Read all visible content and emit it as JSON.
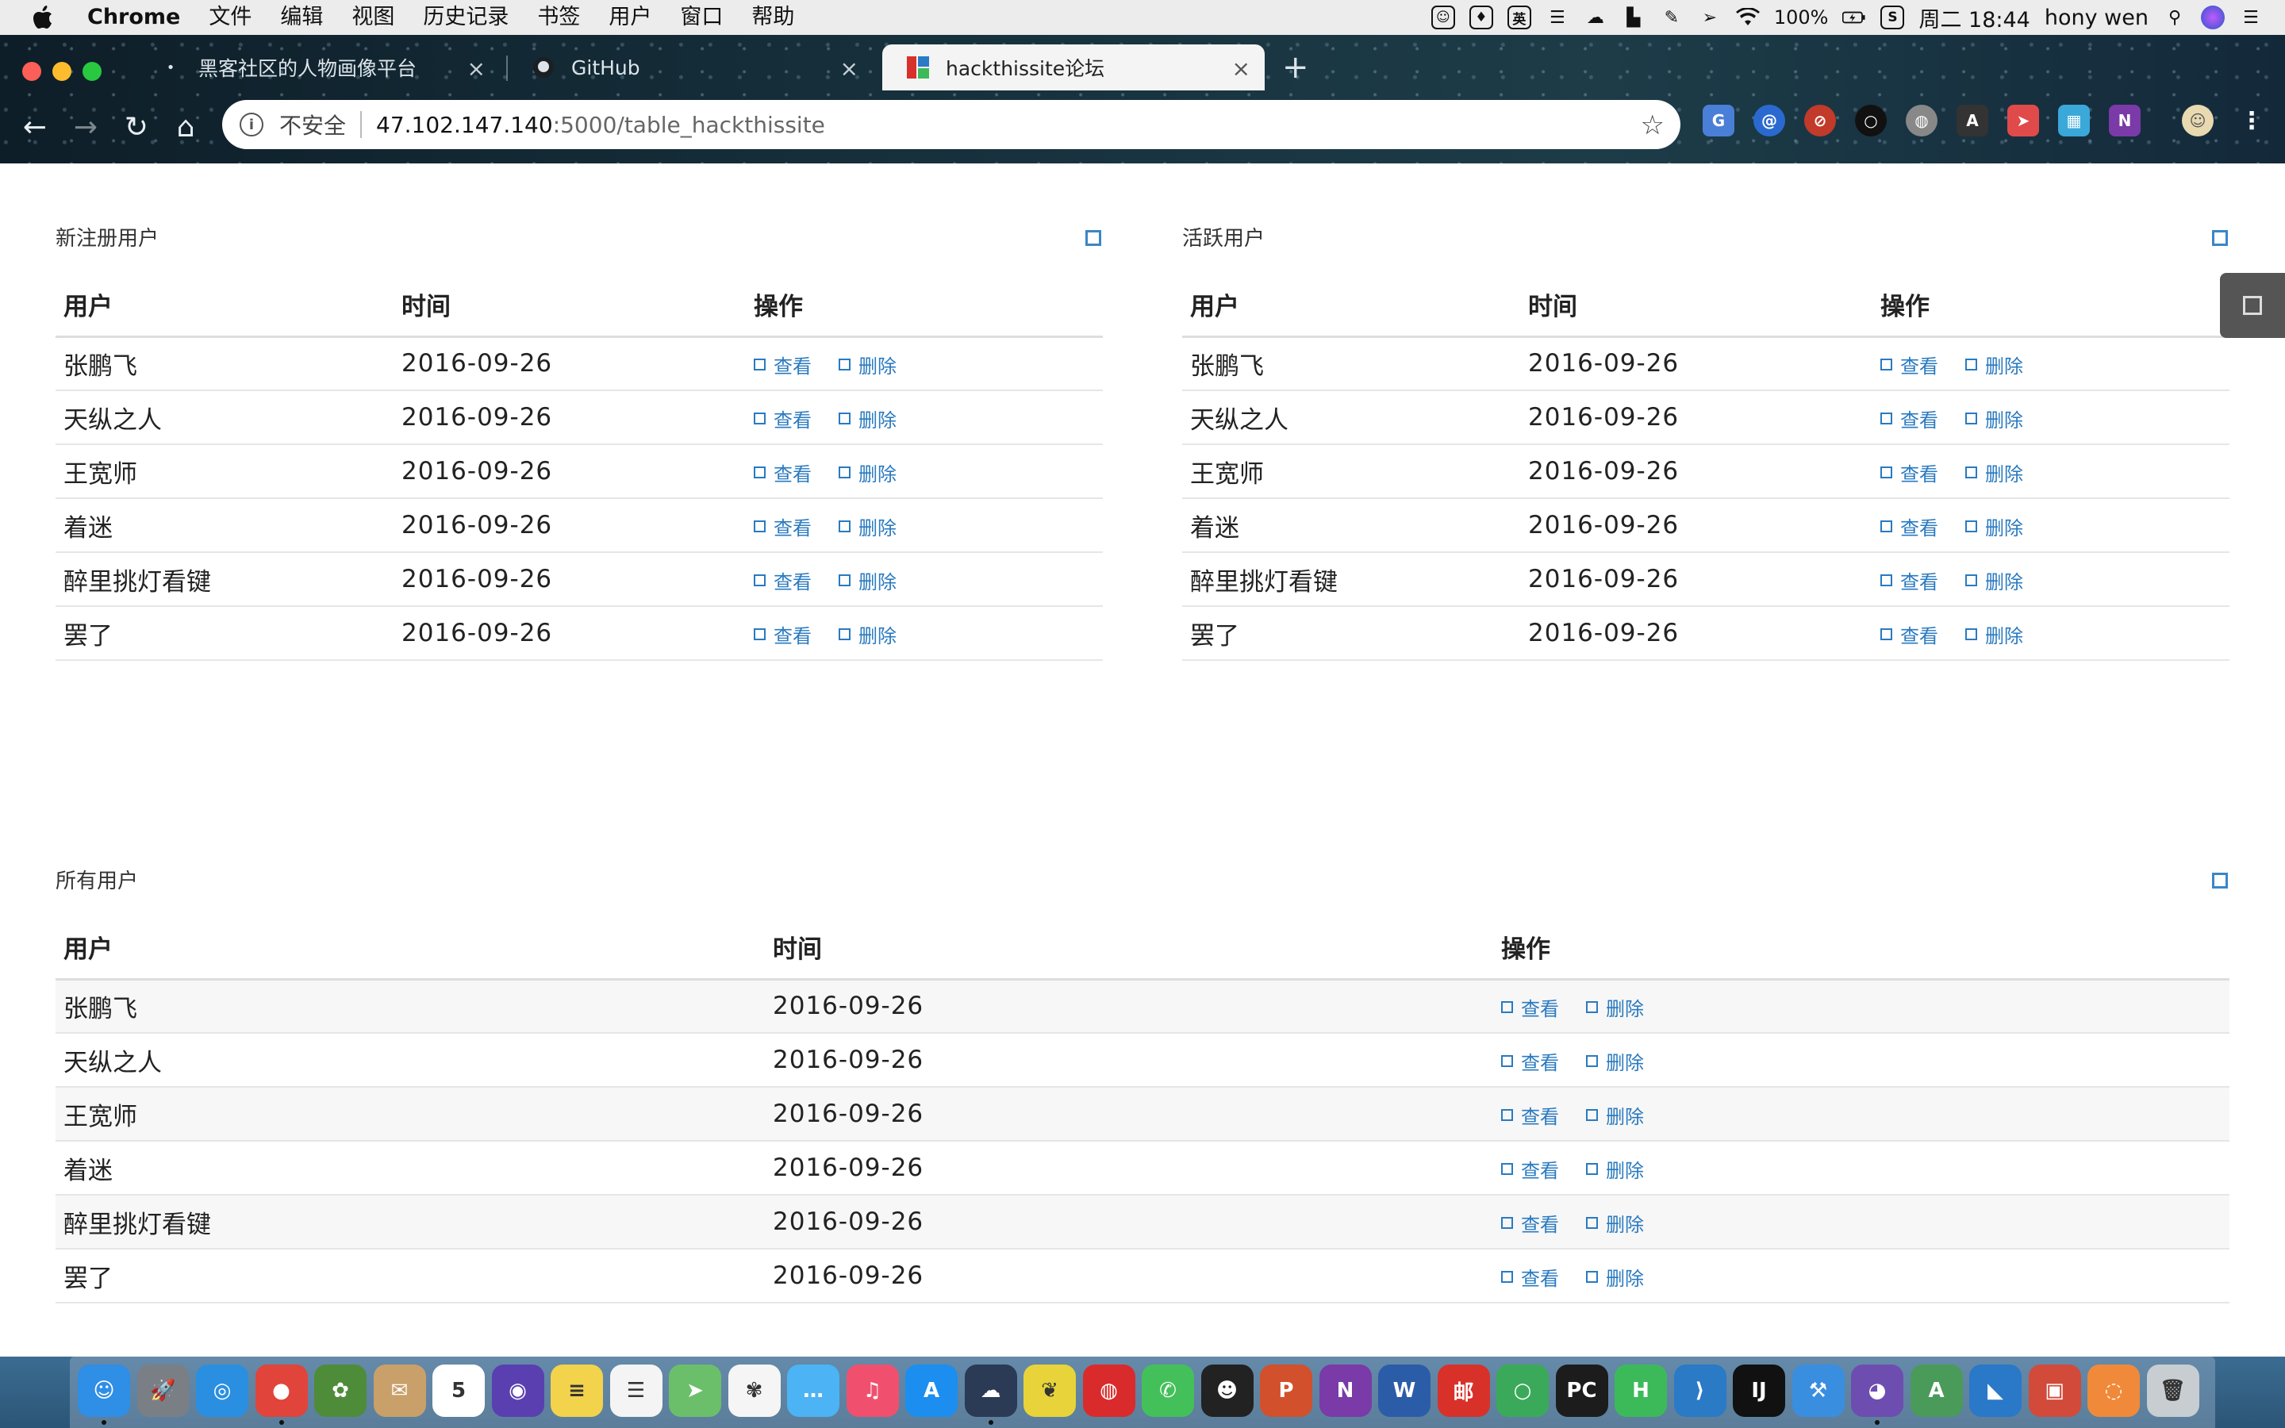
{
  "menubar": {
    "apple": "",
    "items": [
      "Chrome",
      "文件",
      "编辑",
      "视图",
      "历史记录",
      "书签",
      "用户",
      "窗口",
      "帮助"
    ],
    "status": {
      "ime": "英",
      "battery": "100%",
      "clock": "周二 18:44",
      "user": "hony wen"
    }
  },
  "tabs": [
    {
      "title": "黑客社区的人物画像平台",
      "active": false
    },
    {
      "title": "GitHub",
      "active": false
    },
    {
      "title": "hackthissite论坛",
      "active": true
    }
  ],
  "omnibox": {
    "security": "不安全",
    "host": "47.102.147.140",
    "path": ":5000/table_hackthissite"
  },
  "panels": {
    "new_users": {
      "title": "新注册用户",
      "headers": [
        "用户",
        "时间",
        "操作"
      ],
      "rows": [
        {
          "user": "张鹏飞",
          "time": "2016-09-26"
        },
        {
          "user": "天纵之人",
          "time": "2016-09-26"
        },
        {
          "user": "王宽师",
          "time": "2016-09-26"
        },
        {
          "user": "着迷",
          "time": "2016-09-26"
        },
        {
          "user": "醉里挑灯看键",
          "time": "2016-09-26"
        },
        {
          "user": "罢了",
          "time": "2016-09-26"
        }
      ]
    },
    "active_users": {
      "title": "活跃用户",
      "headers": [
        "用户",
        "时间",
        "操作"
      ],
      "rows": [
        {
          "user": "张鹏飞",
          "time": "2016-09-26"
        },
        {
          "user": "天纵之人",
          "time": "2016-09-26"
        },
        {
          "user": "王宽师",
          "time": "2016-09-26"
        },
        {
          "user": "着迷",
          "time": "2016-09-26"
        },
        {
          "user": "醉里挑灯看键",
          "time": "2016-09-26"
        },
        {
          "user": "罢了",
          "time": "2016-09-26"
        }
      ]
    },
    "all_users": {
      "title": "所有用户",
      "headers": [
        "用户",
        "时间",
        "操作"
      ],
      "rows": [
        {
          "user": "张鹏飞",
          "time": "2016-09-26"
        },
        {
          "user": "天纵之人",
          "time": "2016-09-26"
        },
        {
          "user": "王宽师",
          "time": "2016-09-26"
        },
        {
          "user": "着迷",
          "time": "2016-09-26"
        },
        {
          "user": "醉里挑灯看键",
          "time": "2016-09-26"
        },
        {
          "user": "罢了",
          "time": "2016-09-26"
        }
      ]
    }
  },
  "actions": {
    "view": "查看",
    "delete": "删除"
  },
  "dock": [
    {
      "name": "finder-icon",
      "color": "#2f8ee6",
      "glyph": "☺"
    },
    {
      "name": "launchpad-icon",
      "color": "#7a7f86",
      "glyph": "🚀"
    },
    {
      "name": "safari-icon",
      "color": "#2a8fe0",
      "glyph": "◎"
    },
    {
      "name": "chrome-icon",
      "color": "#e0443a",
      "glyph": "●"
    },
    {
      "name": "mastering-icon",
      "color": "#4e8c3a",
      "glyph": "✿"
    },
    {
      "name": "stamp-icon",
      "color": "#c9a06a",
      "glyph": "✉"
    },
    {
      "name": "calendar-icon",
      "color": "#ffffff",
      "glyph": "5"
    },
    {
      "name": "siri-icon",
      "color": "#5a3fb0",
      "glyph": "◉"
    },
    {
      "name": "notes-icon",
      "color": "#f3d24c",
      "glyph": "≡"
    },
    {
      "name": "reminders-icon",
      "color": "#f4f4f4",
      "glyph": "☰"
    },
    {
      "name": "maps-icon",
      "color": "#6cbf6a",
      "glyph": "➤"
    },
    {
      "name": "photos-icon",
      "color": "#f5f5f5",
      "glyph": "✾"
    },
    {
      "name": "messages-icon",
      "color": "#4cb3f4",
      "glyph": "…"
    },
    {
      "name": "music-icon",
      "color": "#f0506e",
      "glyph": "♫"
    },
    {
      "name": "appstore-icon",
      "color": "#1b8ef0",
      "glyph": "A"
    },
    {
      "name": "pupil-icon",
      "color": "#2b3a55",
      "glyph": "☁"
    },
    {
      "name": "feather-icon",
      "color": "#e8d43a",
      "glyph": "❦"
    },
    {
      "name": "netease-music-icon",
      "color": "#d92b2b",
      "glyph": "◍"
    },
    {
      "name": "wechat-icon",
      "color": "#44c05a",
      "glyph": "✆"
    },
    {
      "name": "qq-icon",
      "color": "#222222",
      "glyph": "☻"
    },
    {
      "name": "powerpoint-icon",
      "color": "#d2502b",
      "glyph": "P"
    },
    {
      "name": "onenote-icon",
      "color": "#7a3aa8",
      "glyph": "N"
    },
    {
      "name": "word-icon",
      "color": "#2b5ca8",
      "glyph": "W"
    },
    {
      "name": "mail-app-icon",
      "color": "#d8312a",
      "glyph": "邮"
    },
    {
      "name": "ring-icon",
      "color": "#3aaa5a",
      "glyph": "○"
    },
    {
      "name": "pycharm-icon",
      "color": "#1c1c1c",
      "glyph": "PC"
    },
    {
      "name": "h-app-icon",
      "color": "#3cba5a",
      "glyph": "H"
    },
    {
      "name": "vscode-icon",
      "color": "#2a7ac6",
      "glyph": "⟩"
    },
    {
      "name": "intellij-icon",
      "color": "#111111",
      "glyph": "IJ"
    },
    {
      "name": "xcode-icon",
      "color": "#3a8ee0",
      "glyph": "⚒"
    },
    {
      "name": "github-desktop-icon",
      "color": "#6e4db0",
      "glyph": "◕"
    },
    {
      "name": "android-studio-icon",
      "color": "#4a9a5a",
      "glyph": "A"
    },
    {
      "name": "sharkfin-icon",
      "color": "#2a78c8",
      "glyph": "◣"
    },
    {
      "name": "parallels-icon",
      "color": "#d24a3a",
      "glyph": "▣"
    },
    {
      "name": "colors-icon",
      "color": "#f08a3a",
      "glyph": "◌"
    },
    {
      "name": "trash-icon",
      "color": "#c8cdd2",
      "glyph": "🗑"
    }
  ]
}
